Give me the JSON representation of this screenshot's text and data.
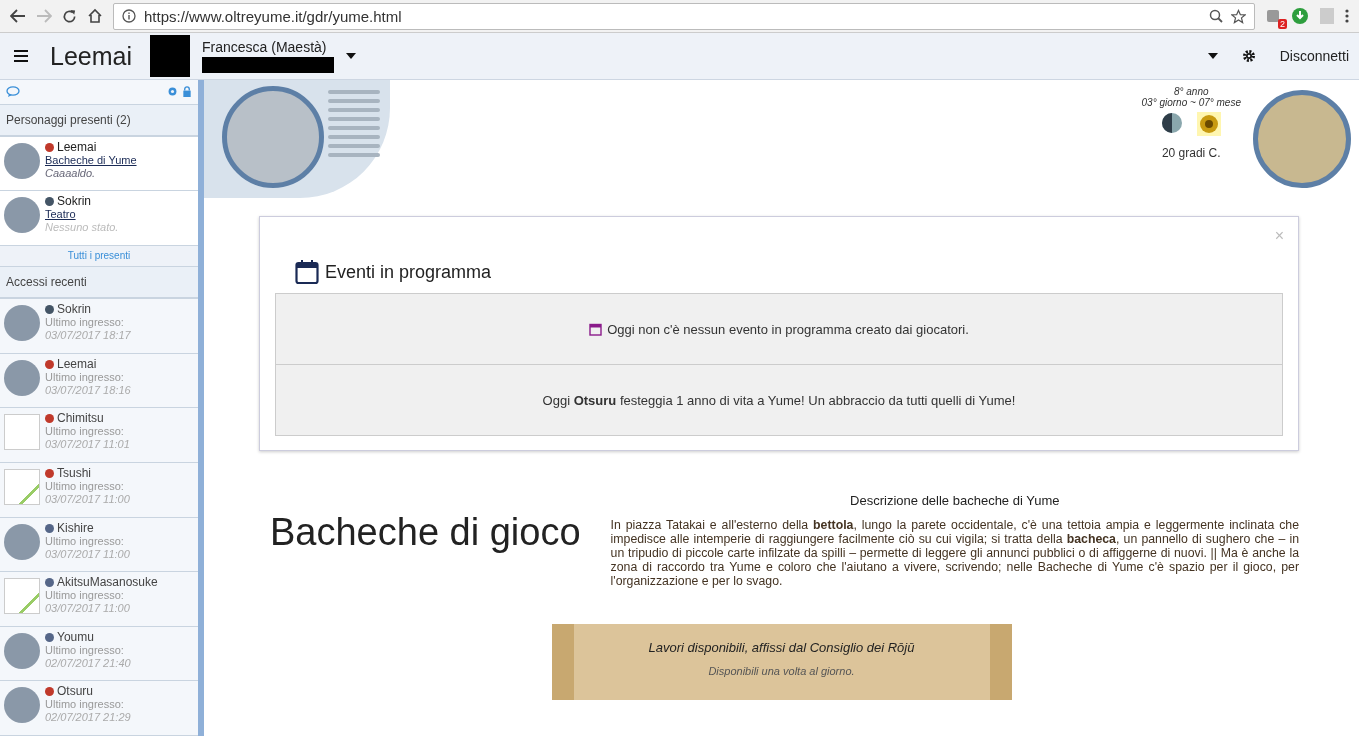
{
  "browser": {
    "url": "https://www.oltreyume.it/gdr/yume.html",
    "extension_badge": "2"
  },
  "header": {
    "character": "Leemai",
    "player": "Francesca (Maestà)",
    "right_link": "Disconnetti"
  },
  "sidebar": {
    "present_title": "Personaggi presenti (2)",
    "present": [
      {
        "name": "Leemai",
        "location": "Bacheche di Yume",
        "status": "Caaaaldo.",
        "status_empty": false,
        "kind": "photo",
        "color": "#c0392b"
      },
      {
        "name": "Sokrin",
        "location": "Teatro",
        "status": "Nessuno stato.",
        "status_empty": true,
        "kind": "photo",
        "color": "#445566"
      }
    ],
    "all_present_link": "Tutti i presenti",
    "recent_title": "Accessi recenti",
    "recent": [
      {
        "name": "Sokrin",
        "label": "Ultimo ingresso:",
        "time": "03/07/2017 18:17",
        "kind": "photo",
        "color": "#445566"
      },
      {
        "name": "Leemai",
        "label": "Ultimo ingresso:",
        "time": "03/07/2017 18:16",
        "kind": "photo",
        "color": "#c0392b"
      },
      {
        "name": "Chimitsu",
        "label": "Ultimo ingresso:",
        "time": "03/07/2017 11:01",
        "kind": "empty",
        "color": "#c0392b"
      },
      {
        "name": "Tsushi",
        "label": "Ultimo ingresso:",
        "time": "03/07/2017 11:00",
        "kind": "broken",
        "color": "#c0392b"
      },
      {
        "name": "Kishire",
        "label": "Ultimo ingresso:",
        "time": "03/07/2017 11:00",
        "kind": "photo",
        "color": "#556688"
      },
      {
        "name": "AkitsuMasanosuke",
        "label": "Ultimo ingresso:",
        "time": "03/07/2017 11:00",
        "kind": "broken",
        "color": "#556688"
      },
      {
        "name": "Youmu",
        "label": "Ultimo ingresso:",
        "time": "02/07/2017 21:40",
        "kind": "photo",
        "color": "#556688"
      },
      {
        "name": "Otsuru",
        "label": "Ultimo ingresso:",
        "time": "02/07/2017 21:29",
        "kind": "photo",
        "color": "#c0392b"
      }
    ]
  },
  "calendar": {
    "year": "8° anno",
    "date": "03° giorno ~ 07° mese",
    "temperature": "20 gradi C."
  },
  "events": {
    "title": "Eventi in programma",
    "close": "×",
    "rows": [
      {
        "kind": "calendar",
        "text": "Oggi non c'è nessun evento in programma creato dai giocatori."
      },
      {
        "kind": "plain",
        "text": "Oggi **Otsuru** festeggia 1 anno di vita a Yume! Un abbraccio da tutti quelli di Yume!"
      }
    ]
  },
  "boards": {
    "title": "Bacheche di gioco",
    "description_title": "Descrizione delle bacheche di Yume",
    "description": "In piazza Tatakai e all'esterno della **bettola**, lungo la parete occidentale, c'è una tettoia ampia e leggermente inclinata che impedisce alle intemperie di raggiungere facilmente ciò su cui vigila; si tratta della **bacheca**, un pannello di sughero che – in un tripudio di piccole carte infilzate da spilli – permette di leggere gli annunci pubblici o di affiggerne di nuovi. || Ma è anche la zona di raccordo tra Yume e coloro che l'aiutano a vivere, scrivendo; nelle Bacheche di Yume c'è spazio per il gioco, per l'organizzazione e per lo svago.",
    "scroll_title": "Lavori disponibili, affissi dal Consiglio dei Rōjū",
    "scroll_note": "Disponibili una volta al giorno."
  }
}
